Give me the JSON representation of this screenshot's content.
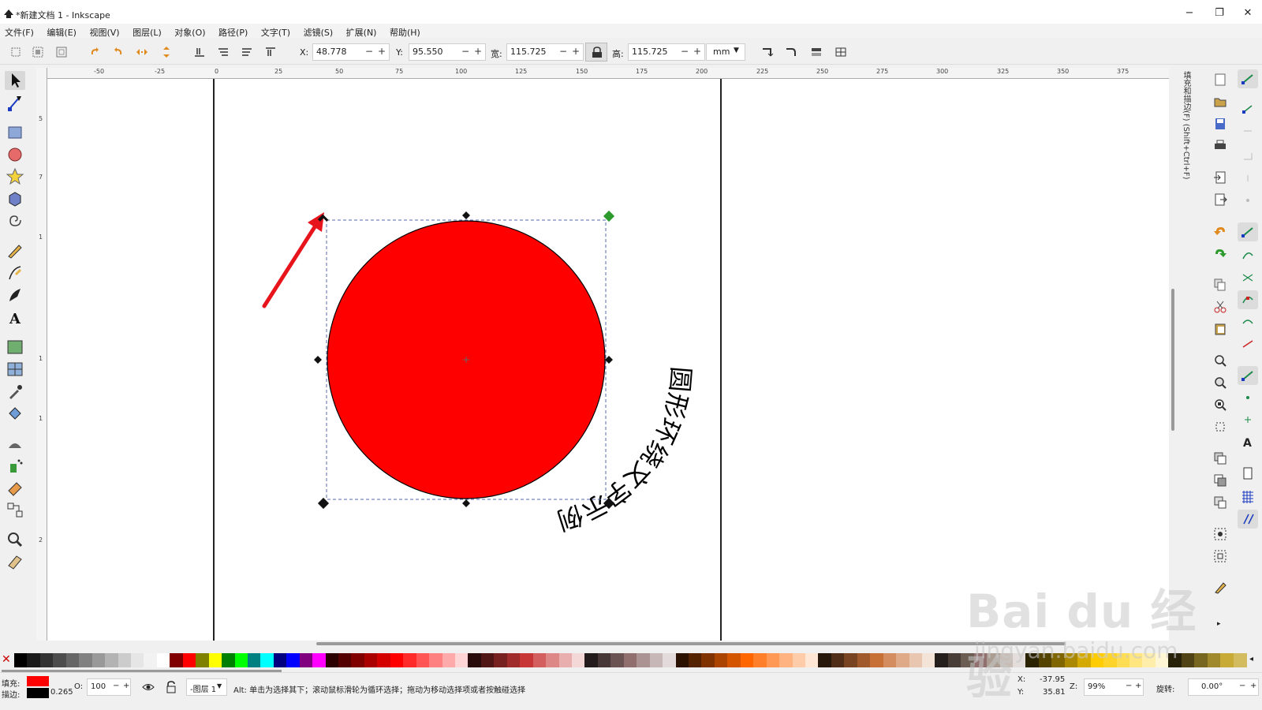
{
  "window": {
    "title": "*新建文档 1 - Inkscape",
    "minimize": "−",
    "maximize": "❐",
    "close": "✕"
  },
  "menu": [
    "文件(F)",
    "编辑(E)",
    "视图(V)",
    "图层(L)",
    "对象(O)",
    "路径(P)",
    "文字(T)",
    "滤镜(S)",
    "扩展(N)",
    "帮助(H)"
  ],
  "controls": {
    "x_label": "X:",
    "x_value": "48.778",
    "y_label": "Y:",
    "y_value": "95.550",
    "w_label": "宽:",
    "w_value": "115.725",
    "h_label": "高:",
    "h_value": "115.725",
    "unit": "mm",
    "minus": "−",
    "plus": "+"
  },
  "ruler": {
    "h_ticks": [
      "-50",
      "-25",
      "0",
      "25",
      "50",
      "75",
      "100",
      "125",
      "150",
      "175",
      "200",
      "225",
      "250",
      "275",
      "300",
      "325",
      "350",
      "375"
    ],
    "v_ticks": [
      "5",
      "7",
      "1",
      "1",
      "1",
      "2"
    ]
  },
  "canvas": {
    "circle_text": "圆形环绕文字示例",
    "fill_color": "#ff0000",
    "stroke_color": "#000000",
    "arrow_color": "#e8141c"
  },
  "dock": {
    "tab_label": "填充和描边(F) (Shift+Ctrl+F)"
  },
  "palette": [
    "#000000",
    "#1a1a1a",
    "#333333",
    "#4d4d4d",
    "#666666",
    "#808080",
    "#999999",
    "#b3b3b3",
    "#cccccc",
    "#e6e6e6",
    "#f2f2f2",
    "#ffffff",
    "#800000",
    "#ff0000",
    "#808000",
    "#ffff00",
    "#008000",
    "#00ff00",
    "#008080",
    "#00ffff",
    "#000080",
    "#0000ff",
    "#800080",
    "#ff00ff",
    "#2b0000",
    "#550000",
    "#800000",
    "#aa0000",
    "#d40000",
    "#ff0000",
    "#ff2a2a",
    "#ff5555",
    "#ff8080",
    "#ffaaaa",
    "#ffd5d5",
    "#280b0b",
    "#501616",
    "#782121",
    "#a02c2c",
    "#c83737",
    "#d35f5f",
    "#de8787",
    "#e9afaf",
    "#f4d7d7",
    "#241c1c",
    "#483737",
    "#6c5353",
    "#916f6f",
    "#ac9393",
    "#c8b7b7",
    "#e3dbdb",
    "#2b1100",
    "#552200",
    "#803300",
    "#aa4400",
    "#d45500",
    "#ff6600",
    "#ff7f2a",
    "#ff9955",
    "#ffb380",
    "#ffccaa",
    "#ffe6d5",
    "#28170b",
    "#502d16",
    "#784421",
    "#a05a2c",
    "#c87137",
    "#d38d5f",
    "#deaa87",
    "#e9c6af",
    "#f4e3d7",
    "#241f1c",
    "#483e37",
    "#6c5d53",
    "#916f6f",
    "#ac9d93",
    "#c8beb7",
    "#e3dedb",
    "#2b2200",
    "#554400",
    "#806600",
    "#aa8800",
    "#d4aa00",
    "#ffcc00",
    "#ffd42a",
    "#ffdd55",
    "#ffe680",
    "#ffeeaa",
    "#fff6d5",
    "#28220b",
    "#504416",
    "#786721",
    "#a0892c",
    "#c8ab37",
    "#d3bc5f"
  ],
  "status": {
    "fill_label": "填充:",
    "stroke_label": "描边:",
    "stroke_width": "0.265",
    "opacity_label": "O:",
    "opacity_value": "100",
    "layer": "-图层 1",
    "hint": "Alt: 单击为选择其下；滚动鼠标滑轮为循环选择；拖动为移动选择项或者按触碰选择",
    "x_label": "X:",
    "x_coord": "-37.95",
    "y_label": "Y:",
    "y_coord": "35.81",
    "zoom_label": "Z:",
    "zoom_value": "99%",
    "rotate_label": "旋转:",
    "rotate_value": "0.00°"
  },
  "watermark": {
    "brand": "Bai du 经验",
    "url": "jingyan.baidu.com"
  }
}
